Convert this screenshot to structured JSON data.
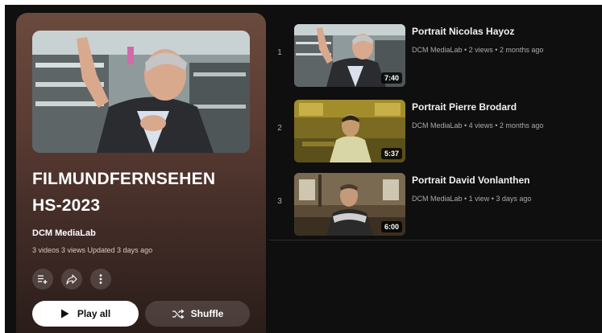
{
  "playlist": {
    "title": "FILMUNDFERNSEHEN\nHS-2023",
    "channel": "DCM MediaLab",
    "meta": "3 videos  3 views  Updated 3 days ago",
    "play_all_label": "Play all",
    "shuffle_label": "Shuffle"
  },
  "icons": {
    "add_to_queue": "playlist-add-icon",
    "share": "share-icon",
    "more": "more-vertical-icon",
    "play": "play-icon",
    "shuffle": "shuffle-icon"
  },
  "videos": [
    {
      "index": "1",
      "title": "Portrait Nicolas Hayoz",
      "meta": "DCM MediaLab • 2 views • 2 months ago",
      "duration": "7:40"
    },
    {
      "index": "2",
      "title": "Portrait Pierre Brodard",
      "meta": "DCM MediaLab • 4 views • 2 months ago",
      "duration": "5:37"
    },
    {
      "index": "3",
      "title": "Portrait David Vonlanthen",
      "meta": "DCM MediaLab • 1 view • 3 days ago",
      "duration": "6:00"
    }
  ],
  "colors": {
    "background": "#0f0f0f",
    "panel_gradient_top": "#6b4a3e",
    "panel_gradient_bottom": "#2a1d1a",
    "secondary_text": "#aaaaaa"
  }
}
